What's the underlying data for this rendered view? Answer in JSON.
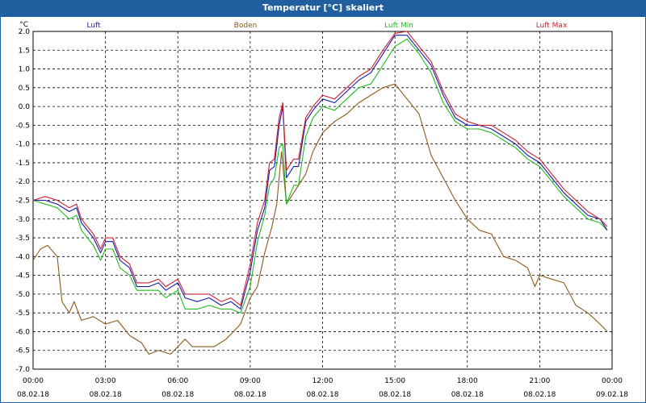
{
  "window": {
    "title": "Temperatur [°C] skaliert"
  },
  "chart_data": {
    "type": "line",
    "ylabel": "°C",
    "ylim": [
      -7.0,
      2.0
    ],
    "yticks": [
      "2.0",
      "1.5",
      "1.0",
      "0.5",
      "0.0",
      "-0.5",
      "-1.0",
      "-1.5",
      "-2.0",
      "-2.5",
      "-3.0",
      "-3.5",
      "-4.0",
      "-4.5",
      "-5.0",
      "-5.5",
      "-6.0",
      "-6.5",
      "-7.0"
    ],
    "xlim_hours": [
      0,
      24
    ],
    "xticks": [
      {
        "time": "00:00",
        "date": "08.02.18"
      },
      {
        "time": "03:00",
        "date": "08.02.18"
      },
      {
        "time": "06:00",
        "date": "08.02.18"
      },
      {
        "time": "09:00",
        "date": "08.02.18"
      },
      {
        "time": "12:00",
        "date": "08.02.18"
      },
      {
        "time": "15:00",
        "date": "08.02.18"
      },
      {
        "time": "18:00",
        "date": "08.02.18"
      },
      {
        "time": "21:00",
        "date": "08.02.18"
      },
      {
        "time": "00:00",
        "date": "09.02.18"
      }
    ],
    "grid": true,
    "legend_position": "top",
    "series": [
      {
        "name": "Luft",
        "color": "#1a1aaa",
        "points": [
          [
            0,
            -2.5
          ],
          [
            0.5,
            -2.5
          ],
          [
            1,
            -2.6
          ],
          [
            1.5,
            -2.8
          ],
          [
            1.8,
            -2.7
          ],
          [
            2,
            -3.1
          ],
          [
            2.5,
            -3.5
          ],
          [
            2.8,
            -3.9
          ],
          [
            3,
            -3.6
          ],
          [
            3.3,
            -3.6
          ],
          [
            3.6,
            -4.1
          ],
          [
            4,
            -4.3
          ],
          [
            4.3,
            -4.8
          ],
          [
            4.8,
            -4.8
          ],
          [
            5.2,
            -4.7
          ],
          [
            5.5,
            -4.9
          ],
          [
            6,
            -4.7
          ],
          [
            6.3,
            -5.1
          ],
          [
            6.8,
            -5.2
          ],
          [
            7.3,
            -5.1
          ],
          [
            7.8,
            -5.3
          ],
          [
            8.2,
            -5.2
          ],
          [
            8.6,
            -5.4
          ],
          [
            9,
            -4.4
          ],
          [
            9.3,
            -3.3
          ],
          [
            9.6,
            -2.7
          ],
          [
            9.8,
            -1.7
          ],
          [
            10,
            -1.6
          ],
          [
            10.2,
            -0.5
          ],
          [
            10.35,
            0.0
          ],
          [
            10.5,
            -1.9
          ],
          [
            10.8,
            -1.6
          ],
          [
            11,
            -1.6
          ],
          [
            11.3,
            -0.4
          ],
          [
            11.6,
            -0.1
          ],
          [
            12,
            0.2
          ],
          [
            12.5,
            0.1
          ],
          [
            13,
            0.4
          ],
          [
            13.5,
            0.7
          ],
          [
            14,
            0.9
          ],
          [
            14.5,
            1.4
          ],
          [
            15,
            1.9
          ],
          [
            15.5,
            1.9
          ],
          [
            16,
            1.5
          ],
          [
            16.5,
            1.1
          ],
          [
            17,
            0.3
          ],
          [
            17.5,
            -0.3
          ],
          [
            18,
            -0.5
          ],
          [
            18.5,
            -0.5
          ],
          [
            19,
            -0.6
          ],
          [
            19.5,
            -0.8
          ],
          [
            20,
            -1.0
          ],
          [
            20.5,
            -1.3
          ],
          [
            21,
            -1.5
          ],
          [
            21.5,
            -1.9
          ],
          [
            22,
            -2.3
          ],
          [
            22.5,
            -2.6
          ],
          [
            23,
            -2.9
          ],
          [
            23.5,
            -3.0
          ],
          [
            23.8,
            -3.3
          ]
        ]
      },
      {
        "name": "Boden",
        "color": "#8a5a1a",
        "points": [
          [
            0,
            -4.1
          ],
          [
            0.3,
            -3.8
          ],
          [
            0.6,
            -3.7
          ],
          [
            1,
            -4.0
          ],
          [
            1.2,
            -5.2
          ],
          [
            1.5,
            -5.5
          ],
          [
            1.7,
            -5.2
          ],
          [
            2,
            -5.7
          ],
          [
            2.5,
            -5.6
          ],
          [
            3,
            -5.8
          ],
          [
            3.5,
            -5.7
          ],
          [
            4,
            -6.1
          ],
          [
            4.5,
            -6.3
          ],
          [
            4.8,
            -6.6
          ],
          [
            5.2,
            -6.5
          ],
          [
            5.7,
            -6.6
          ],
          [
            6,
            -6.4
          ],
          [
            6.3,
            -6.2
          ],
          [
            6.6,
            -6.4
          ],
          [
            7,
            -6.4
          ],
          [
            7.5,
            -6.4
          ],
          [
            8,
            -6.2
          ],
          [
            8.6,
            -5.8
          ],
          [
            9,
            -5.1
          ],
          [
            9.3,
            -4.8
          ],
          [
            9.6,
            -3.9
          ],
          [
            9.9,
            -3.2
          ],
          [
            10.1,
            -2.6
          ],
          [
            10.3,
            -1.2
          ],
          [
            10.5,
            -2.6
          ],
          [
            10.8,
            -2.3
          ],
          [
            11,
            -2.1
          ],
          [
            11.3,
            -1.8
          ],
          [
            11.6,
            -1.2
          ],
          [
            12,
            -0.7
          ],
          [
            12.5,
            -0.4
          ],
          [
            13,
            -0.2
          ],
          [
            13.5,
            0.1
          ],
          [
            14,
            0.3
          ],
          [
            14.5,
            0.5
          ],
          [
            15,
            0.6
          ],
          [
            15.5,
            0.2
          ],
          [
            16,
            -0.2
          ],
          [
            16.5,
            -1.3
          ],
          [
            17,
            -1.9
          ],
          [
            17.5,
            -2.5
          ],
          [
            18,
            -3.0
          ],
          [
            18.5,
            -3.3
          ],
          [
            19,
            -3.4
          ],
          [
            19.5,
            -4.0
          ],
          [
            20,
            -4.1
          ],
          [
            20.5,
            -4.3
          ],
          [
            20.8,
            -4.8
          ],
          [
            21,
            -4.5
          ],
          [
            21.5,
            -4.6
          ],
          [
            22,
            -4.7
          ],
          [
            22.5,
            -5.3
          ],
          [
            23,
            -5.5
          ],
          [
            23.5,
            -5.8
          ],
          [
            23.8,
            -6.0
          ]
        ]
      },
      {
        "name": "Luft Min",
        "color": "#22bb22",
        "points": [
          [
            0,
            -2.5
          ],
          [
            0.5,
            -2.6
          ],
          [
            1,
            -2.7
          ],
          [
            1.5,
            -3.0
          ],
          [
            1.8,
            -2.9
          ],
          [
            2,
            -3.3
          ],
          [
            2.5,
            -3.7
          ],
          [
            2.8,
            -4.1
          ],
          [
            3,
            -3.8
          ],
          [
            3.3,
            -3.8
          ],
          [
            3.6,
            -4.3
          ],
          [
            4,
            -4.5
          ],
          [
            4.3,
            -4.9
          ],
          [
            4.8,
            -4.9
          ],
          [
            5.2,
            -4.9
          ],
          [
            5.5,
            -5.1
          ],
          [
            6,
            -4.9
          ],
          [
            6.3,
            -5.4
          ],
          [
            6.8,
            -5.4
          ],
          [
            7.3,
            -5.3
          ],
          [
            7.8,
            -5.4
          ],
          [
            8.2,
            -5.4
          ],
          [
            8.6,
            -5.5
          ],
          [
            9,
            -4.8
          ],
          [
            9.3,
            -3.6
          ],
          [
            9.6,
            -2.9
          ],
          [
            9.8,
            -2.1
          ],
          [
            10,
            -1.9
          ],
          [
            10.2,
            -1.1
          ],
          [
            10.35,
            -1.0
          ],
          [
            10.5,
            -2.6
          ],
          [
            10.8,
            -2.1
          ],
          [
            11,
            -2.1
          ],
          [
            11.3,
            -0.8
          ],
          [
            11.6,
            -0.3
          ],
          [
            12,
            0.0
          ],
          [
            12.5,
            -0.1
          ],
          [
            13,
            0.2
          ],
          [
            13.5,
            0.5
          ],
          [
            14,
            0.6
          ],
          [
            14.5,
            1.1
          ],
          [
            15,
            1.6
          ],
          [
            15.5,
            1.8
          ],
          [
            16,
            1.4
          ],
          [
            16.5,
            0.9
          ],
          [
            17,
            0.1
          ],
          [
            17.5,
            -0.4
          ],
          [
            18,
            -0.6
          ],
          [
            18.5,
            -0.6
          ],
          [
            19,
            -0.7
          ],
          [
            19.5,
            -0.9
          ],
          [
            20,
            -1.1
          ],
          [
            20.5,
            -1.4
          ],
          [
            21,
            -1.6
          ],
          [
            21.5,
            -2.0
          ],
          [
            22,
            -2.4
          ],
          [
            22.5,
            -2.7
          ],
          [
            23,
            -3.0
          ],
          [
            23.5,
            -3.1
          ],
          [
            23.8,
            -3.3
          ]
        ]
      },
      {
        "name": "Luft Max",
        "color": "#cc2233",
        "points": [
          [
            0,
            -2.5
          ],
          [
            0.5,
            -2.4
          ],
          [
            1,
            -2.5
          ],
          [
            1.5,
            -2.7
          ],
          [
            1.8,
            -2.6
          ],
          [
            2,
            -3.0
          ],
          [
            2.5,
            -3.4
          ],
          [
            2.8,
            -3.8
          ],
          [
            3,
            -3.5
          ],
          [
            3.3,
            -3.5
          ],
          [
            3.6,
            -4.0
          ],
          [
            4,
            -4.2
          ],
          [
            4.3,
            -4.7
          ],
          [
            4.8,
            -4.7
          ],
          [
            5.2,
            -4.6
          ],
          [
            5.5,
            -4.8
          ],
          [
            6,
            -4.6
          ],
          [
            6.3,
            -5.0
          ],
          [
            6.8,
            -5.0
          ],
          [
            7.3,
            -5.0
          ],
          [
            7.8,
            -5.2
          ],
          [
            8.2,
            -5.1
          ],
          [
            8.6,
            -5.3
          ],
          [
            9,
            -4.2
          ],
          [
            9.3,
            -3.1
          ],
          [
            9.6,
            -2.5
          ],
          [
            9.8,
            -1.5
          ],
          [
            10,
            -1.4
          ],
          [
            10.2,
            -0.3
          ],
          [
            10.35,
            0.1
          ],
          [
            10.5,
            -1.7
          ],
          [
            10.8,
            -1.4
          ],
          [
            11,
            -1.4
          ],
          [
            11.3,
            -0.3
          ],
          [
            11.6,
            0.0
          ],
          [
            12,
            0.3
          ],
          [
            12.5,
            0.2
          ],
          [
            13,
            0.5
          ],
          [
            13.5,
            0.8
          ],
          [
            14,
            1.0
          ],
          [
            14.5,
            1.5
          ],
          [
            15,
            1.95
          ],
          [
            15.5,
            2.0
          ],
          [
            16,
            1.6
          ],
          [
            16.5,
            1.2
          ],
          [
            17,
            0.4
          ],
          [
            17.5,
            -0.2
          ],
          [
            18,
            -0.4
          ],
          [
            18.5,
            -0.5
          ],
          [
            19,
            -0.5
          ],
          [
            19.5,
            -0.7
          ],
          [
            20,
            -0.9
          ],
          [
            20.5,
            -1.2
          ],
          [
            21,
            -1.4
          ],
          [
            21.5,
            -1.8
          ],
          [
            22,
            -2.2
          ],
          [
            22.5,
            -2.5
          ],
          [
            23,
            -2.8
          ],
          [
            23.5,
            -3.0
          ],
          [
            23.8,
            -3.2
          ]
        ]
      }
    ]
  }
}
